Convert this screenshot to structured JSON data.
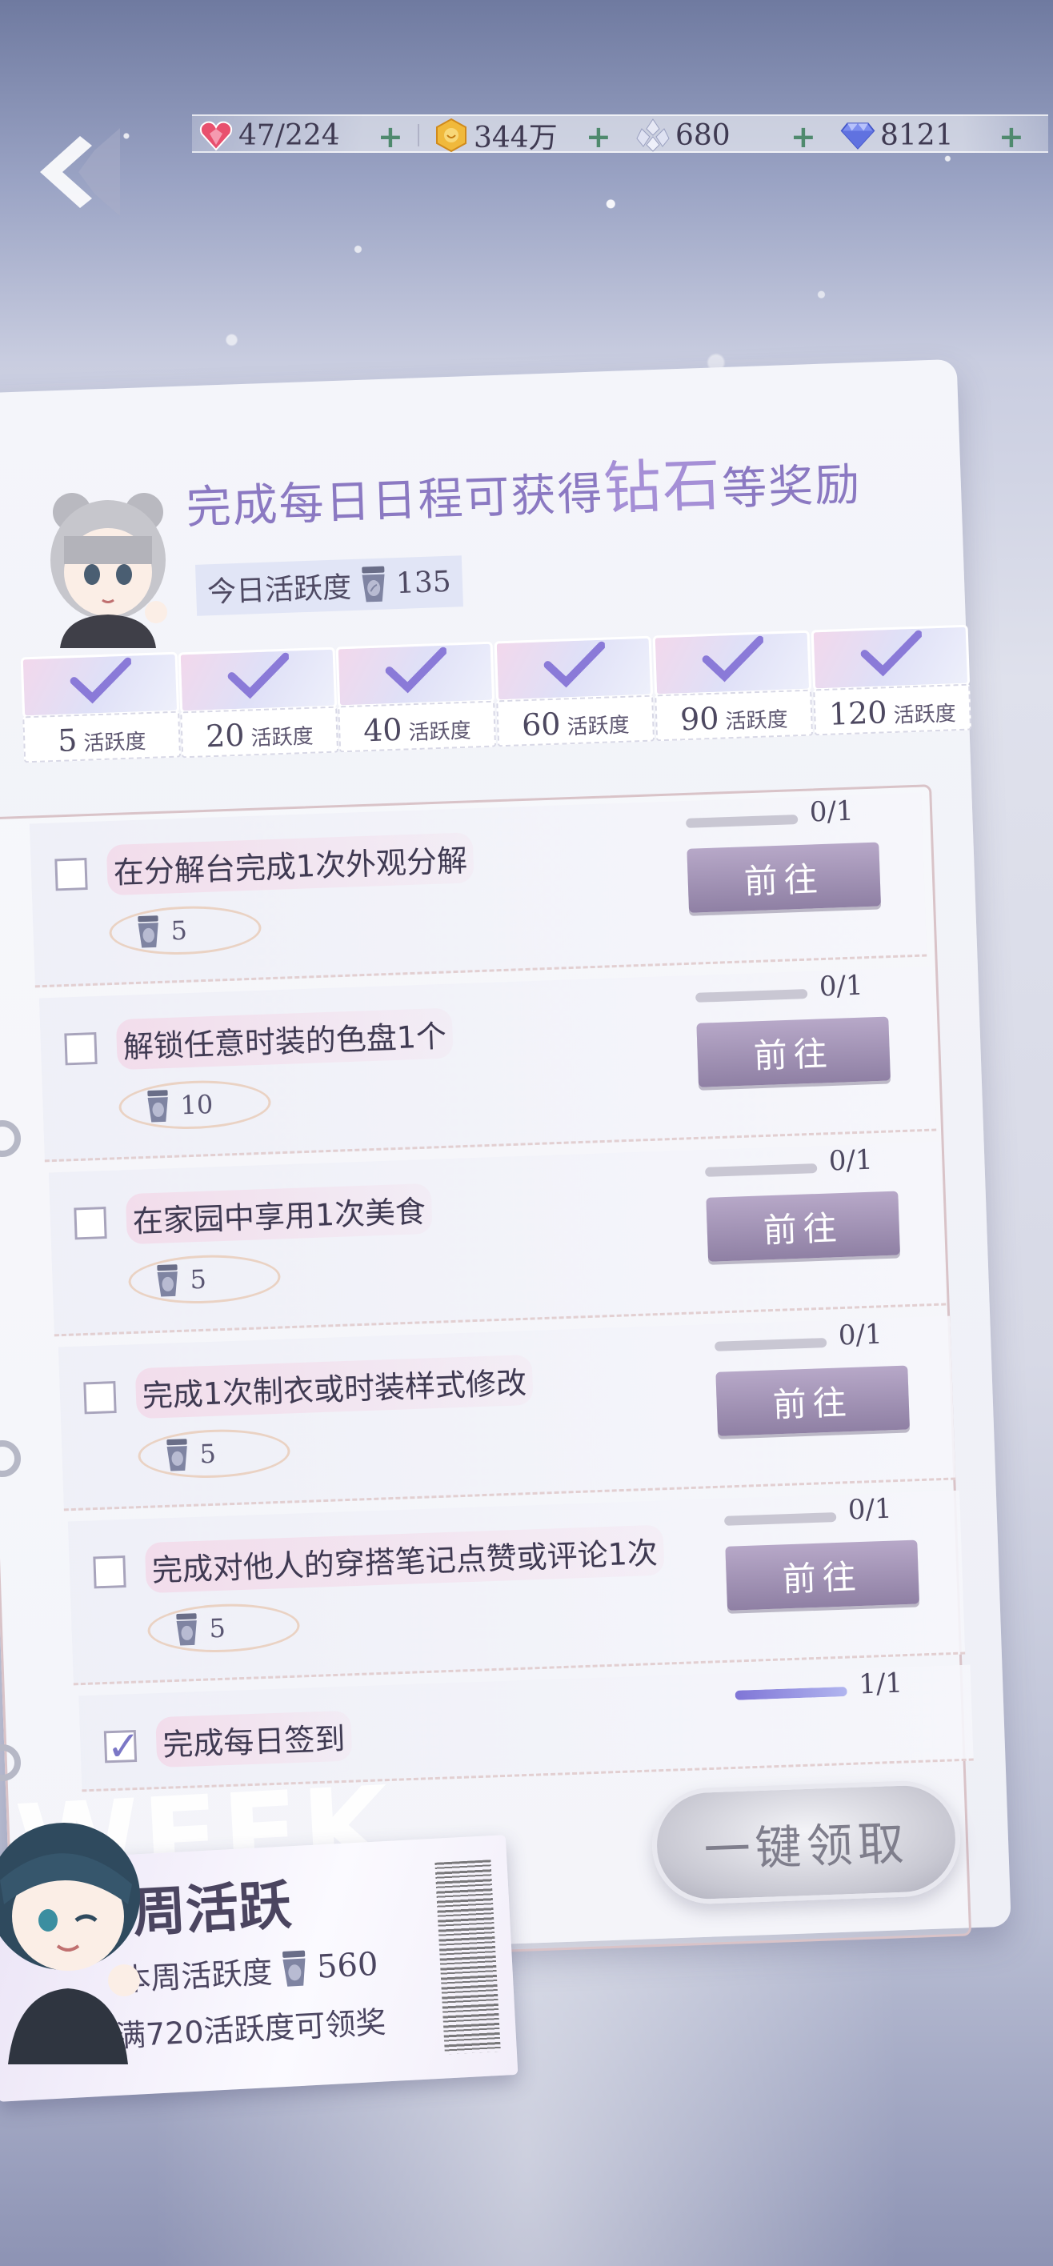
{
  "resources": [
    {
      "icon": "heart-gem-icon",
      "value": "47/224"
    },
    {
      "icon": "gold-coin-icon",
      "value": "344万"
    },
    {
      "icon": "crystal-cluster-icon",
      "value": "680"
    },
    {
      "icon": "diamond-icon",
      "value": "8121"
    }
  ],
  "header": {
    "title_a": "完成每日日程可获得",
    "title_b": "钻石",
    "title_c": "等奖励",
    "activity_label": "今日活跃度",
    "activity_value": "135"
  },
  "milestones": [
    {
      "value": "5",
      "unit": "活跃度"
    },
    {
      "value": "20",
      "unit": "活跃度"
    },
    {
      "value": "40",
      "unit": "活跃度"
    },
    {
      "value": "60",
      "unit": "活跃度"
    },
    {
      "value": "90",
      "unit": "活跃度"
    },
    {
      "value": "120",
      "unit": "活跃度"
    }
  ],
  "tasks": [
    {
      "title": "在分解台完成1次外观分解",
      "reward": "5",
      "progress_text": "0/1",
      "progress": 0,
      "button": "前往"
    },
    {
      "title": "解锁任意时装的色盘1个",
      "reward": "10",
      "progress_text": "0/1",
      "progress": 0,
      "button": "前往"
    },
    {
      "title": "在家园中享用1次美食",
      "reward": "5",
      "progress_text": "0/1",
      "progress": 0,
      "button": "前往"
    },
    {
      "title": "完成1次制衣或时装样式修改",
      "reward": "5",
      "progress_text": "0/1",
      "progress": 0,
      "button": "前往"
    },
    {
      "title": "完成对他人的穿搭笔记点赞或评论1次",
      "reward": "5",
      "progress_text": "0/1",
      "progress": 0,
      "button": "前往"
    },
    {
      "title": "完成每日签到",
      "progress_text": "1/1",
      "progress": 1
    }
  ],
  "claim_all": "一键领取",
  "weekly": {
    "bg_text": "WEEK",
    "title": "周活跃",
    "label": "本周活跃度",
    "value": "560",
    "note": "满720活跃度可领奖"
  },
  "colors": {
    "accent": "#8b79c2",
    "button": "#9d8fb3",
    "plus": "#4f8a6e"
  }
}
